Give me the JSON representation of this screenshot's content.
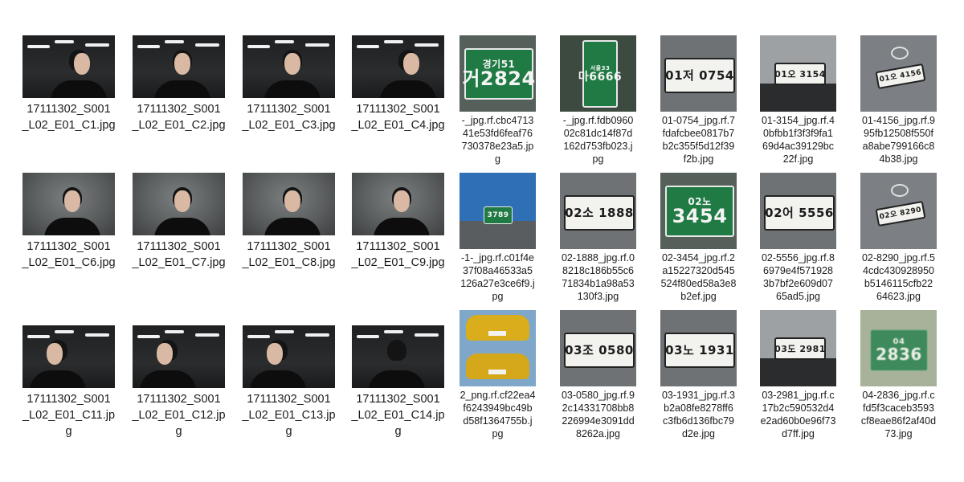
{
  "colors": {
    "background": "#ffffff",
    "label_text": "#1a1a1a",
    "plate_green": "#1f7a43",
    "plate_white": "#f2f2ee"
  },
  "portraits": [
    {
      "filename": "17111302_S001_L02_E01_C1.jpg",
      "pose": "profile-right"
    },
    {
      "filename": "17111302_S001_L02_E01_C2.jpg",
      "pose": "three-quarter"
    },
    {
      "filename": "17111302_S001_L02_E01_C3.jpg",
      "pose": "three-quarter"
    },
    {
      "filename": "17111302_S001_L02_E01_C4.jpg",
      "pose": "profile-right"
    },
    {
      "filename": "17111302_S001_L02_E01_C6.jpg",
      "pose": "frontal"
    },
    {
      "filename": "17111302_S001_L02_E01_C7.jpg",
      "pose": "frontal"
    },
    {
      "filename": "17111302_S001_L02_E01_C8.jpg",
      "pose": "frontal"
    },
    {
      "filename": "17111302_S001_L02_E01_C9.jpg",
      "pose": "frontal"
    },
    {
      "filename": "17111302_S001_L02_E01_C11.jpg",
      "pose": "profile-left"
    },
    {
      "filename": "17111302_S001_L02_E01_C12.jpg",
      "pose": "profile-left"
    },
    {
      "filename": "17111302_S001_L02_E01_C13.jpg",
      "pose": "profile-left"
    },
    {
      "filename": "17111302_S001_L02_E01_C14.jpg",
      "pose": "back"
    }
  ],
  "plates": [
    {
      "filename": "-_jpg.rf.cbc471341e53fd6feaf76730378e23a5.jpg",
      "plate_top": "경기51",
      "plate_text": "거2824",
      "style": "green"
    },
    {
      "filename": "-_jpg.rf.fdb096002c81dc14f87d162d753fb023.jpg",
      "plate_top": "서울33",
      "plate_text": "마6666",
      "style": "green-vertical"
    },
    {
      "filename": "01-0754_jpg.rf.7fdafcbee0817b7b2c355f5d12f39f2b.jpg",
      "plate_top": "",
      "plate_text": "01저 0754",
      "style": "white"
    },
    {
      "filename": "01-3154_jpg.rf.40bfbb1f3f3f9fa169d4ac39129bc22f.jpg",
      "plate_top": "",
      "plate_text": "01오 3154",
      "style": "white-car"
    },
    {
      "filename": "01-4156_jpg.rf.995fb12508f550fa8abe799166c84b38.jpg",
      "plate_top": "",
      "plate_text": "01오 4156",
      "style": "car-rear"
    },
    {
      "filename": "-1-_jpg.rf.c01f4e37f08a46533a5126a27e3ce6f9.jpg",
      "plate_top": "",
      "plate_text": "3789",
      "style": "bus"
    },
    {
      "filename": "02-1888_jpg.rf.08218c186b55c671834b1a98a53130f3.jpg",
      "plate_top": "",
      "plate_text": "02소 1888",
      "style": "white"
    },
    {
      "filename": "02-3454_jpg.rf.2a15227320d545524f80ed58a3e8b2ef.jpg",
      "plate_top": "02노",
      "plate_text": "3454",
      "style": "green"
    },
    {
      "filename": "02-5556_jpg.rf.86979e4f5719283b7bf2e609d0765ad5.jpg",
      "plate_top": "",
      "plate_text": "02어 5556",
      "style": "white"
    },
    {
      "filename": "02-8290_jpg.rf.54cdc430928950b5146115cfb2264623.jpg",
      "plate_top": "",
      "plate_text": "02오 8290",
      "style": "car-rear"
    },
    {
      "filename": "2_png.rf.cf22ea4f6243949bc49bd58f1364755b.jpg",
      "plate_top": "",
      "plate_text": "",
      "style": "cars"
    },
    {
      "filename": "03-0580_jpg.rf.92c14331708bb8226994e3091dd8262a.jpg",
      "plate_top": "",
      "plate_text": "03조 0580",
      "style": "white"
    },
    {
      "filename": "03-1931_jpg.rf.3b2a08fe8278ff6c3fb6d136fbc79d2e.jpg",
      "plate_top": "",
      "plate_text": "03노 1931",
      "style": "white"
    },
    {
      "filename": "03-2981_jpg.rf.c17b2c590532d4e2ad60b0e96f73d7ff.jpg",
      "plate_top": "",
      "plate_text": "03도 2981",
      "style": "white-car"
    },
    {
      "filename": "04-2836_jpg.rf.cfd5f3caceb3593cf8eae86f2af40d73.jpg",
      "plate_top": "04",
      "plate_text": "2836",
      "style": "green-blur"
    }
  ],
  "captions": [
    [
      "17111302_S001",
      "_L02_E01_C1.jpg"
    ],
    [
      "17111302_S001",
      "_L02_E01_C2.jpg"
    ],
    [
      "17111302_S001",
      "_L02_E01_C3.jpg"
    ],
    [
      "17111302_S001",
      "_L02_E01_C4.jpg"
    ],
    [
      "17111302_S001",
      "_L02_E01_C6.jpg"
    ],
    [
      "17111302_S001",
      "_L02_E01_C7.jpg"
    ],
    [
      "17111302_S001",
      "_L02_E01_C8.jpg"
    ],
    [
      "17111302_S001",
      "_L02_E01_C9.jpg"
    ],
    [
      "17111302_S001",
      "_L02_E01_C11.jp",
      "g"
    ],
    [
      "17111302_S001",
      "_L02_E01_C12.jp",
      "g"
    ],
    [
      "17111302_S001",
      "_L02_E01_C13.jp",
      "g"
    ],
    [
      "17111302_S001",
      "_L02_E01_C14.jp",
      "g"
    ]
  ],
  "plate_captions": [
    [
      "-_jpg.rf.cbc4713",
      "41e53fd6feaf76",
      "730378e23a5.jp",
      "g"
    ],
    [
      "-_jpg.rf.fdb0960",
      "02c81dc14f87d",
      "162d753fb023.j",
      "pg"
    ],
    [
      "01-0754_jpg.rf.7",
      "fdafcbee0817b7",
      "b2c355f5d12f39",
      "f2b.jpg"
    ],
    [
      "01-3154_jpg.rf.4",
      "0bfbb1f3f3f9fa1",
      "69d4ac39129bc",
      "22f.jpg"
    ],
    [
      "01-4156_jpg.rf.9",
      "95fb12508f550f",
      "a8abe799166c8",
      "4b38.jpg"
    ],
    [
      "-1-_jpg.rf.c01f4e",
      "37f08a46533a5",
      "126a27e3ce6f9.j",
      "pg"
    ],
    [
      "02-1888_jpg.rf.0",
      "8218c186b55c6",
      "71834b1a98a53",
      "130f3.jpg"
    ],
    [
      "02-3454_jpg.rf.2",
      "a15227320d545",
      "524f80ed58a3e8",
      "b2ef.jpg"
    ],
    [
      "02-5556_jpg.rf.8",
      "6979e4f571928",
      "3b7bf2e609d07",
      "65ad5.jpg"
    ],
    [
      "02-8290_jpg.rf.5",
      "4cdc430928950",
      "b5146115cfb22",
      "64623.jpg"
    ],
    [
      "2_png.rf.cf22ea4",
      "f6243949bc49b",
      "d58f1364755b.j",
      "pg"
    ],
    [
      "03-0580_jpg.rf.9",
      "2c14331708bb8",
      "226994e3091dd",
      "8262a.jpg"
    ],
    [
      "03-1931_jpg.rf.3",
      "b2a08fe8278ff6",
      "c3fb6d136fbc79",
      "d2e.jpg"
    ],
    [
      "03-2981_jpg.rf.c",
      "17b2c590532d4",
      "e2ad60b0e96f73",
      "d7ff.jpg"
    ],
    [
      "04-2836_jpg.rf.c",
      "fd5f3caceb3593",
      "cf8eae86f2af40d",
      "73.jpg"
    ]
  ]
}
